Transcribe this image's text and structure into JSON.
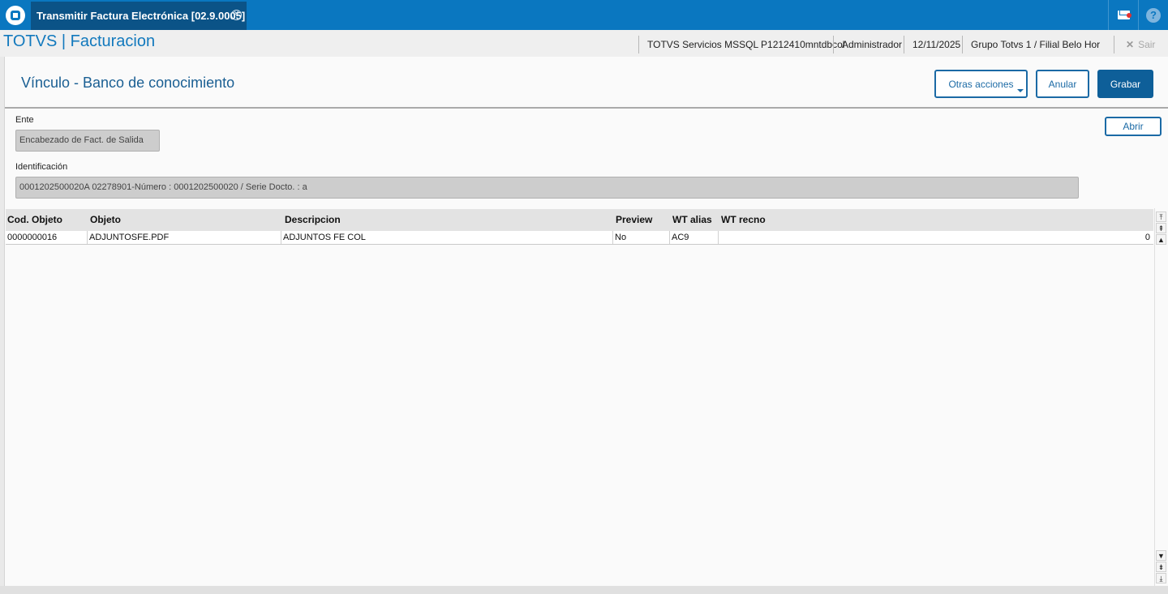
{
  "topbar": {
    "tab_title": "Transmitir Factura Electrónica [02.9.0005]",
    "tab_close_glyph": "✕",
    "mail_icon": "mail-icon",
    "help_glyph": "?"
  },
  "header": {
    "app_title": "TOTVS | Facturacion",
    "environment": "TOTVS Servicios MSSQL P1212410mntdbcol",
    "user": "Administrador",
    "date": "12/11/2025",
    "branch": "Grupo Totvs 1 / Filial Belo Hor",
    "exit_label": "Sair",
    "exit_glyph": "✕"
  },
  "form": {
    "title": "Vínculo - Banco de conocimiento",
    "buttons": {
      "more_actions": "Otras acciones",
      "cancel": "Anular",
      "save": "Grabar",
      "open": "Abrir"
    },
    "fields": {
      "entity_label": "Ente",
      "entity_value": "Encabezado de Fact. de Salida",
      "identification_label": "Identificación",
      "identification_value": "0001202500020A  02278901-Número : 0001202500020 / Serie Docto. : a"
    }
  },
  "grid": {
    "columns": [
      "Cod. Objeto",
      "Objeto",
      "Descripcion",
      "Preview",
      "WT alias",
      "WT recno"
    ],
    "rows": [
      [
        "0000000016",
        "ADJUNTOSFE.PDF",
        "ADJUNTOS FE COL",
        "No",
        "AC9",
        "0"
      ]
    ]
  },
  "scrollbar": {
    "top_glyph": "⤒",
    "page_up_glyph": "⇞",
    "up_glyph": "▲",
    "down_glyph": "▼",
    "page_down_glyph": "⇟",
    "bottom_glyph": "⤓"
  },
  "colors": {
    "topbar": "#0a77c0",
    "active_tab": "#0b5387",
    "primary_button": "#0e5f99",
    "title_text": "#1279bd"
  }
}
